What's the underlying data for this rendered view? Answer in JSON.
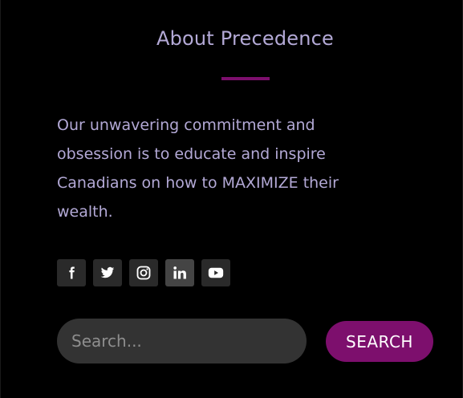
{
  "about": {
    "title": "About Precedence",
    "body": "Our unwavering commitment and obsession is to educate and inspire Canadians on how to MAXIMIZE their wealth."
  },
  "social": {
    "items": [
      {
        "name": "facebook-icon"
      },
      {
        "name": "twitter-icon"
      },
      {
        "name": "instagram-icon"
      },
      {
        "name": "linkedin-icon"
      },
      {
        "name": "youtube-icon"
      }
    ]
  },
  "search": {
    "placeholder": "Search...",
    "button_label": "SEARCH"
  },
  "colors": {
    "background": "#000000",
    "text": "#b3a9d6",
    "accent": "#7d0f6d",
    "icon_bg": "#2a2a2a",
    "input_bg": "#333333"
  }
}
